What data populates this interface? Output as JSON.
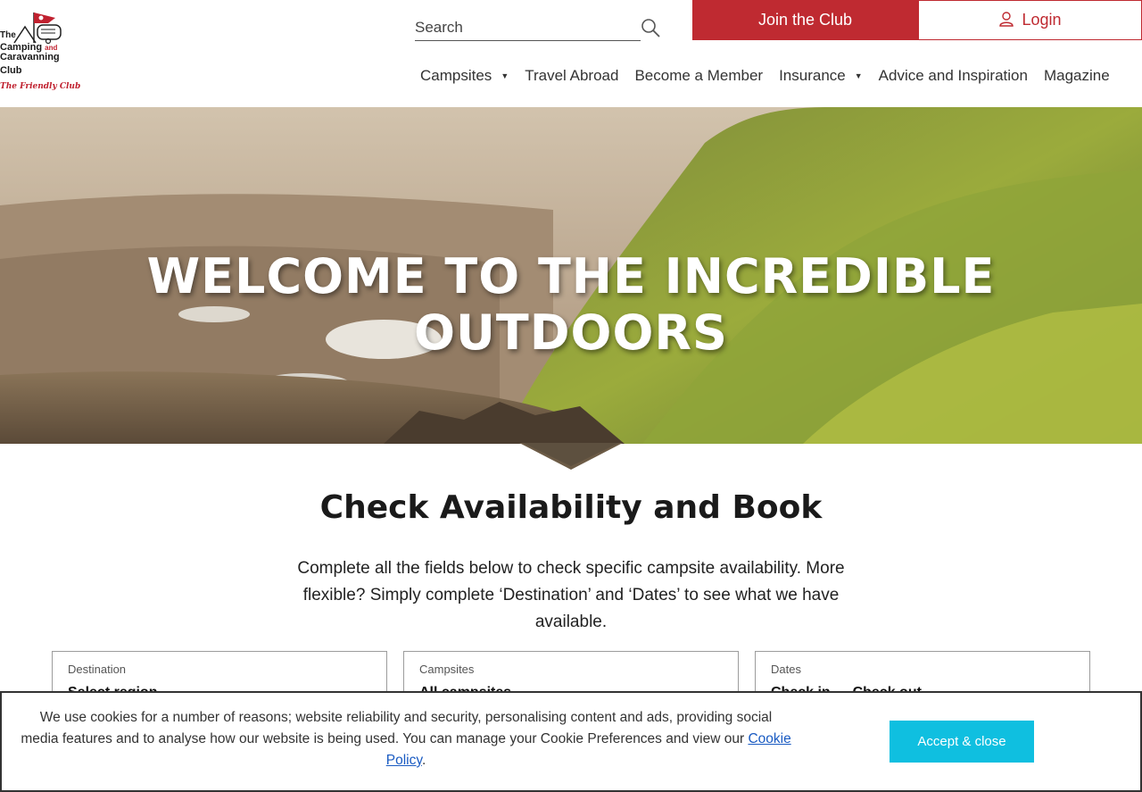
{
  "logo": {
    "line1": "The",
    "line2": "Camping",
    "and": "and",
    "line3": "Caravanning",
    "line4": "Club",
    "tagline": "The Friendly Club"
  },
  "search": {
    "placeholder": "Search"
  },
  "header": {
    "join_label": "Join the Club",
    "login_label": "Login"
  },
  "nav": {
    "items": [
      {
        "label": "Campsites",
        "has_dropdown": true
      },
      {
        "label": "Travel Abroad",
        "has_dropdown": false
      },
      {
        "label": "Become a Member",
        "has_dropdown": false
      },
      {
        "label": "Insurance",
        "has_dropdown": true
      },
      {
        "label": "Advice and Inspiration",
        "has_dropdown": false
      },
      {
        "label": "Magazine",
        "has_dropdown": false
      }
    ]
  },
  "hero": {
    "title": "Welcome to the incredible outdoors"
  },
  "booking": {
    "title": "Check Availability and Book",
    "intro": "Complete all the fields below to check specific campsite availability. More flexible? Simply complete ‘Destination’ and ‘Dates’ to see what we have available.",
    "fields": [
      {
        "label": "Destination",
        "value": "Select region"
      },
      {
        "label": "Campsites",
        "value": "All campsites"
      },
      {
        "label": "Dates",
        "value": "Check in  →  Check out"
      }
    ]
  },
  "cookie": {
    "text": "We use cookies for a number of reasons; website reliability and security, personalising content and ads, providing social media features and to analyse how our website is being used. You can manage your Cookie Preferences and view our ",
    "link_label": "Cookie Policy",
    "text_end": ".",
    "button_label": "Accept & close"
  },
  "colors": {
    "brand_red": "#bf2a31",
    "accept_button": "#0fbfe0",
    "link": "#1a5bc2"
  }
}
